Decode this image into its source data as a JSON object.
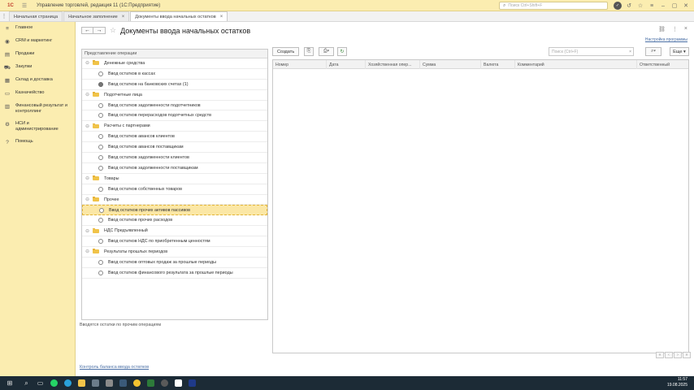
{
  "titlebar": {
    "logo": "1С",
    "app_title": "Управление торговлей, редакция 11  (1С:Предприятие)",
    "search_placeholder": "Поиск Ctrl+Shift+F"
  },
  "tabs": [
    {
      "label": "Начальная страница"
    },
    {
      "label": "Начальное заполнение"
    },
    {
      "label": "Документы ввода начальных остатков"
    }
  ],
  "sidebar": {
    "items": [
      {
        "label": "Главное",
        "icon": "menu-icon"
      },
      {
        "label": "CRM и маркетинг",
        "icon": "crm-icon"
      },
      {
        "label": "Продажи",
        "icon": "sales-icon"
      },
      {
        "label": "Закупки",
        "icon": "cart-icon"
      },
      {
        "label": "Склад и доставка",
        "icon": "warehouse-icon"
      },
      {
        "label": "Казначейство",
        "icon": "treasury-icon"
      },
      {
        "label": "Финансовый результат и\nконтроллинг",
        "icon": "finance-icon"
      },
      {
        "label": "НСИ и\nадминистрирование",
        "icon": "admin-icon"
      },
      {
        "label": "Помощь",
        "icon": "help-icon"
      }
    ]
  },
  "page": {
    "title": "Документы ввода начальных остатков",
    "settings_link": "Настройка программы"
  },
  "tree": {
    "header": "Представление операции",
    "rows": [
      {
        "type": "group",
        "label": "Денежные средства"
      },
      {
        "type": "item",
        "label": "Ввод остатков в кассах"
      },
      {
        "type": "item",
        "label": "Ввод остатков на банковских счетах (1)",
        "checked": true
      },
      {
        "type": "group",
        "label": "Подотчетные лица"
      },
      {
        "type": "item",
        "label": "Ввод остатков задолженности подотчетников"
      },
      {
        "type": "item",
        "label": "Ввод остатков перерасходов подотчетных средств"
      },
      {
        "type": "group",
        "label": "Расчеты с партнерами"
      },
      {
        "type": "item",
        "label": "Ввод остатков авансов клиентов"
      },
      {
        "type": "item",
        "label": "Ввод остатков авансов поставщикам"
      },
      {
        "type": "item",
        "label": "Ввод остатков задолженности клиентов"
      },
      {
        "type": "item",
        "label": "Ввод остатков задолженности поставщикам"
      },
      {
        "type": "group",
        "label": "Товары"
      },
      {
        "type": "item",
        "label": "Ввод остатков собственных товаров"
      },
      {
        "type": "group",
        "label": "Прочее"
      },
      {
        "type": "item",
        "label": "Ввод остатков прочих активов пассивов",
        "selected": true
      },
      {
        "type": "item",
        "label": "Ввод остатков прочих расходов"
      },
      {
        "type": "group",
        "label": "НДС Предъявленный"
      },
      {
        "type": "item",
        "label": "Ввод остатков НДС по приобретенным ценностям"
      },
      {
        "type": "group",
        "label": "Результаты прошлых периодов"
      },
      {
        "type": "item",
        "label": "Ввод остатков оптовых продаж за прошлые периоды"
      },
      {
        "type": "item",
        "label": "Ввод остатков финансового результата за прошлые периоды"
      }
    ],
    "description": "Вводятся остатки по прочим операциям",
    "bottom_link": "Контроль баланса ввода остатков"
  },
  "list": {
    "create_label": "Создать",
    "search_placeholder": "Поиск (Ctrl+F)",
    "more_label": "Еще",
    "columns": [
      "Номер",
      "Дата",
      "Хозяйственная опер...",
      "Сумма",
      "Валюта",
      "Комментарий",
      "Ответственный"
    ]
  },
  "taskbar": {
    "time": "11:57",
    "date": "19.08.2025"
  },
  "colors": {
    "sidebar_bg": "#fbedb0",
    "selection": "#fbe7a5",
    "link": "#4a6fa5"
  }
}
